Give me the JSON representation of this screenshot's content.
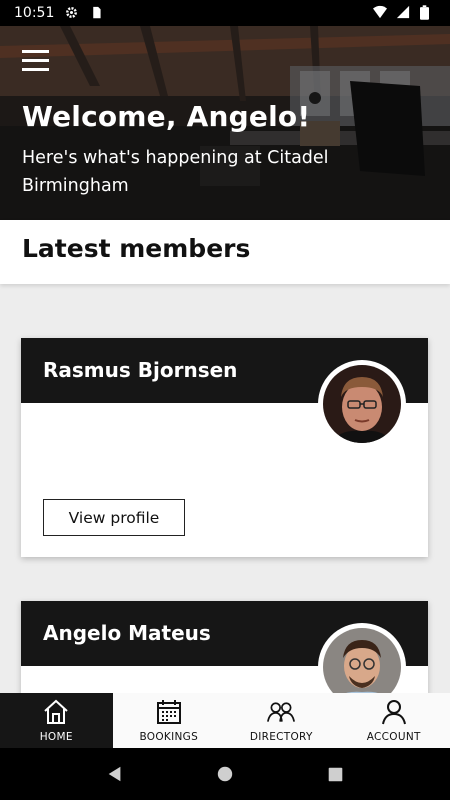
{
  "status_bar": {
    "time": "10:51",
    "icons": [
      "gear-icon",
      "sd-card-icon",
      "wifi-icon",
      "signal-icon",
      "battery-icon"
    ]
  },
  "hero": {
    "title": "Welcome, Angelo!",
    "subtitle": "Here's what's happening at Citadel Birmingham"
  },
  "section": {
    "title": "Latest members"
  },
  "members": [
    {
      "name": "Rasmus Bjornsen",
      "button": "View profile"
    },
    {
      "name": "Angelo Mateus"
    }
  ],
  "bottom_nav": {
    "items": [
      {
        "label": "HOME",
        "icon": "home-icon",
        "active": true
      },
      {
        "label": "BOOKINGS",
        "icon": "calendar-icon",
        "active": false
      },
      {
        "label": "DIRECTORY",
        "icon": "people-icon",
        "active": false
      },
      {
        "label": "ACCOUNT",
        "icon": "person-icon",
        "active": false
      }
    ]
  },
  "colors": {
    "dark": "#161616",
    "bg": "#ededed",
    "white": "#ffffff"
  }
}
